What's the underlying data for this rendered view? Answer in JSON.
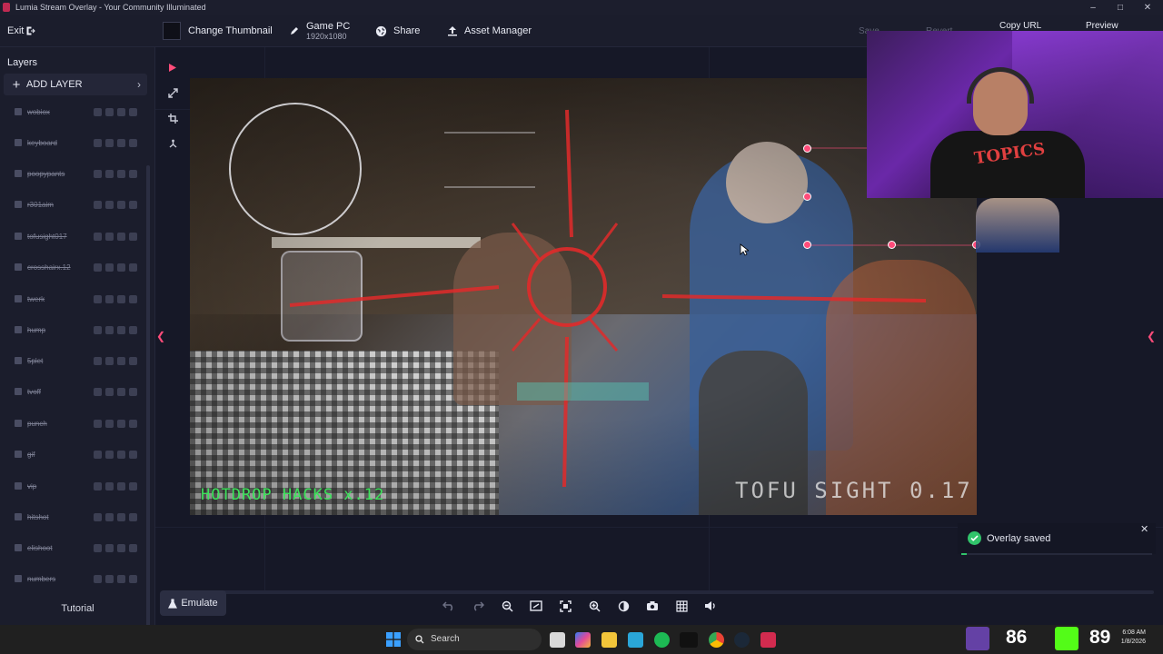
{
  "window": {
    "title": "Lumia Stream Overlay - Your Community Illuminated"
  },
  "toolbar": {
    "exit_label": "Exit",
    "change_thumbnail_label": "Change Thumbnail",
    "game_pc_name": "Game PC",
    "game_pc_resolution": "1920x1080",
    "share_label": "Share",
    "asset_manager_label": "Asset Manager",
    "save_label": "Save",
    "revert_label": "Revert",
    "copy_url_label": "Copy URL",
    "preview_label": "Preview"
  },
  "left_panel": {
    "title": "Layers",
    "add_layer_label": "ADD LAYER",
    "layers": [
      {
        "name": "wobiox"
      },
      {
        "name": "keyboard"
      },
      {
        "name": "poopypants"
      },
      {
        "name": "r301aim"
      },
      {
        "name": "tofusight017"
      },
      {
        "name": "crosshairx.12"
      },
      {
        "name": "twerk"
      },
      {
        "name": "hump"
      },
      {
        "name": "5plet"
      },
      {
        "name": "tvoff"
      },
      {
        "name": "punch"
      },
      {
        "name": "gif"
      },
      {
        "name": "vip"
      },
      {
        "name": "hitshot"
      },
      {
        "name": "elishoot"
      },
      {
        "name": "numbers"
      }
    ],
    "tutorial_label": "Tutorial"
  },
  "canvas": {
    "overlay_text_left": "HOTDROP HACKS x.12",
    "overlay_text_right": "TOFU SIGHT 0.17",
    "webcam_shirt_text": "TOPICS"
  },
  "toast": {
    "message": "Overlay saved",
    "progress": 0.03
  },
  "bottom": {
    "emulate_label": "Emulate",
    "tools": [
      "undo-icon",
      "redo-icon",
      "zoom-out-icon",
      "fit-screen-icon",
      "center-focus-icon",
      "zoom-in-icon",
      "contrast-icon",
      "camera-icon",
      "grid-icon",
      "volume-icon"
    ]
  },
  "taskbar": {
    "search_label": "Search",
    "score_left": "86",
    "score_right": "89",
    "time": "6:08 AM",
    "date": "1/8/2026"
  },
  "colors": {
    "accent": "#ff4c7a",
    "success": "#31c46b",
    "panel": "#1b1d2c",
    "canvas": "#161827"
  }
}
